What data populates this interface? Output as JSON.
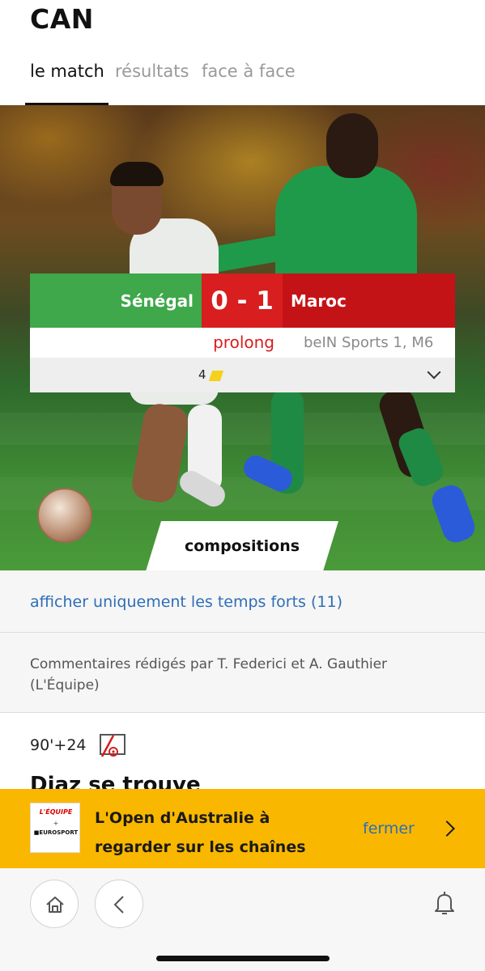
{
  "header": {
    "title": "CAN",
    "tabs": [
      {
        "label": "le match",
        "active": true
      },
      {
        "label": "résultats",
        "active": false
      },
      {
        "label": "face à face",
        "active": false
      }
    ]
  },
  "match": {
    "home_team": "Sénégal",
    "away_team": "Maroc",
    "score": "0 - 1",
    "status": "prolong",
    "broadcast": "beIN Sports 1, M6",
    "yellow_cards": "4",
    "colors": {
      "home": "#3ea84a",
      "score": "#d81e1e",
      "away": "#c41317",
      "yellow_card": "#f4d21b"
    }
  },
  "compositions_label": "compositions",
  "highlights_link": "afficher uniquement les temps forts (11)",
  "credits": "Commentaires rédigés par T. Federici et A. Gauthier (L'Équipe)",
  "event": {
    "minute": "90'+24",
    "icon": "var-penalty-icon",
    "headline": "Diaz se trouve"
  },
  "promo": {
    "logo_top": "L'ÉQUIPE",
    "logo_plus": "+",
    "logo_bottom": "■EUROSPORT",
    "text": "L'Open d'Australie à regarder sur les chaînes",
    "close_label": "fermer",
    "background": "#f9b700"
  },
  "bottom_nav": {
    "icons": [
      "home-icon",
      "back-icon",
      "bell-icon"
    ]
  }
}
